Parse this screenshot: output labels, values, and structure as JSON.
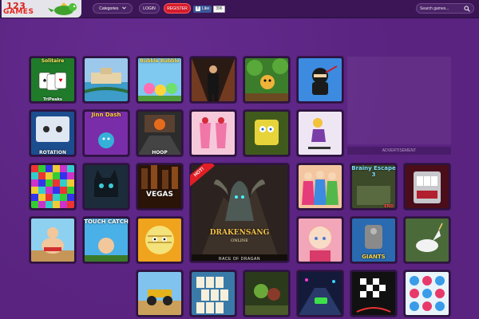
{
  "header": {
    "logo": {
      "number": "123",
      "word": "GAMES"
    },
    "categories_label": "Categories",
    "login_label": "LOGIN",
    "register_label": "REGISTER",
    "facebook": {
      "like_label": "Like",
      "count": "396"
    },
    "search": {
      "placeholder": "Search games..."
    }
  },
  "games": {
    "solitaire": {
      "title": "Solitaire",
      "sub": "TriPeaks"
    },
    "resort": {
      "title": ""
    },
    "bubble_bubble": {
      "title": "Bubble Bubble"
    },
    "agent": {
      "title": ""
    },
    "jungle": {
      "title": ""
    },
    "ninja": {
      "title": ""
    },
    "rotation": {
      "title": "ROTATION"
    },
    "jinn_dash": {
      "title": "Jinn Dash"
    },
    "hoop": {
      "title": "HOOP"
    },
    "smoothies": {
      "title": ""
    },
    "sponge": {
      "title": ""
    },
    "skater": {
      "title": ""
    },
    "blocks": {
      "title": ""
    },
    "cat": {
      "title": ""
    },
    "vegas": {
      "title": "VEGAS"
    },
    "drakensang": {
      "title": "DRAKENSANG",
      "sub": "ONLINE",
      "hot": "HOT!",
      "caption": "RACE OF DRAGAN"
    },
    "girls": {
      "title": ""
    },
    "brainy": {
      "title": "Brainy Escape 3",
      "badge": "END"
    },
    "slots": {
      "title": ""
    },
    "sumo": {
      "title": ""
    },
    "touch_catch": {
      "title": "TOUCH CATCH"
    },
    "mummy": {
      "title": ""
    },
    "doll": {
      "title": ""
    },
    "giants": {
      "title": "GIANTS"
    },
    "unicorn": {
      "title": ""
    },
    "atv": {
      "title": ""
    },
    "mahjong": {
      "title": ""
    },
    "goblins": {
      "title": ""
    },
    "racer": {
      "title": ""
    },
    "chess": {
      "title": ""
    },
    "pills": {
      "title": ""
    }
  },
  "ad": {
    "label": "ADVERTISEMENT"
  }
}
